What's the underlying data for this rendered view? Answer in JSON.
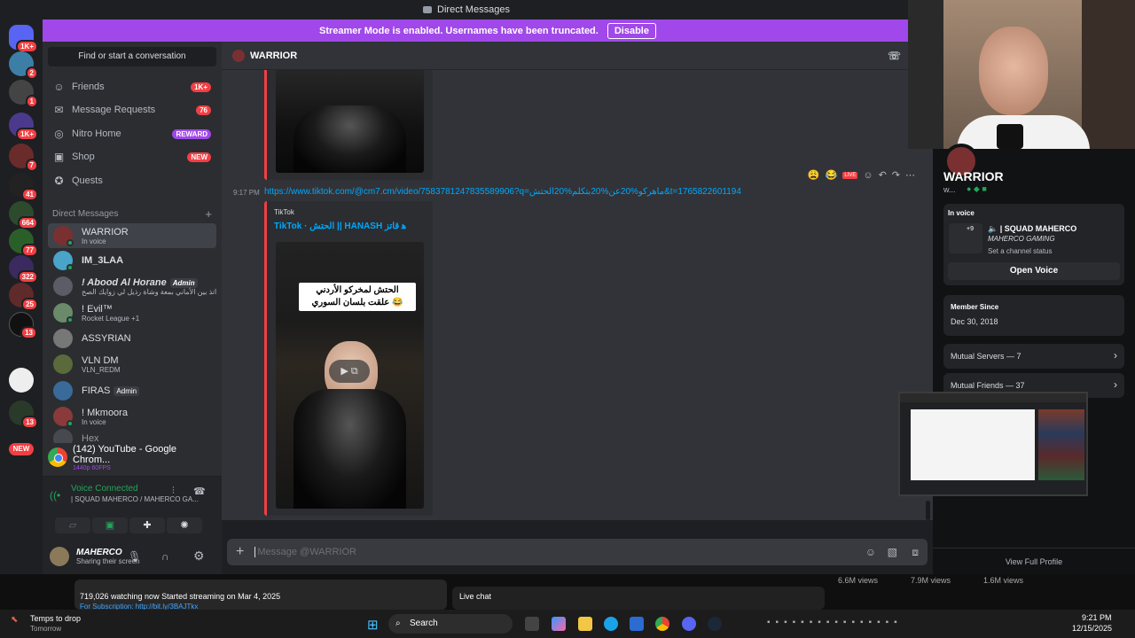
{
  "window": {
    "title": "Direct Messages"
  },
  "banner": {
    "text": "Streamer Mode is enabled. Usernames have been truncated.",
    "button": "Disable"
  },
  "rail": {
    "badges": [
      "1K+",
      "2",
      "1",
      "1K+",
      "7",
      "41",
      "664",
      "77",
      "322",
      "25",
      "13",
      "13"
    ],
    "new_label": "NEW"
  },
  "sidebar": {
    "search_placeholder": "Find or start a conversation",
    "nav": [
      {
        "label": "Friends",
        "badge": "1K+",
        "icon": "friends-icon"
      },
      {
        "label": "Message Requests",
        "badge": "76",
        "icon": "mail-icon"
      },
      {
        "label": "Nitro Home",
        "badge": "REWARD",
        "icon": "nitro-icon"
      },
      {
        "label": "Shop",
        "badge": "NEW",
        "icon": "shop-icon"
      },
      {
        "label": "Quests",
        "badge": "",
        "icon": "quests-icon"
      }
    ],
    "dm_header": "Direct Messages",
    "dms": [
      {
        "name": "WARRIOR",
        "sub": "In voice"
      },
      {
        "name": "IM_3LAA",
        "sub": ""
      },
      {
        "name": "! Abood Al Horane",
        "tag": "Admin",
        "sub": "اتذ بين الأماني بمعة وشاة رذيل لي زوايك الصح..."
      },
      {
        "name": "! Evil™",
        "sub": "Rocket League +1"
      },
      {
        "name": "ASSYRIAN",
        "sub": ""
      },
      {
        "name": "VLN DM",
        "sub": "VLN_REDM"
      },
      {
        "name": "FIRAS",
        "tag": "Admin",
        "sub": ""
      },
      {
        "name": "! Mkmoora",
        "sub": "In voice"
      },
      {
        "name": "Hex",
        "sub": ""
      }
    ],
    "stream": {
      "title": "(142) YouTube - Google Chrom...",
      "quality": "1440p 60FPS"
    },
    "voice": {
      "status": "Voice Connected",
      "channel": "| SQUAD MAHERCO / MAHERCO GA..."
    },
    "user": {
      "name": "MAHERCO",
      "status": "Sharing their screen"
    }
  },
  "chat": {
    "header": "WARRIOR",
    "time": "9:17 PM",
    "link": "https://www.tiktok.com/@cm7.cm/video/7583781247835589906?q=ماهركو%20عن%20بتكلم%20الحتش&t=1765822601194",
    "embed_provider": "TikTok",
    "embed_title": "TikTok · الحتش || HANASH ﮬ قاتز",
    "caption_line1": "الحتش لمخركو الأردني",
    "caption_line2": "علقت بلسان السوري 😂",
    "input_placeholder": "Message @WARRIOR",
    "live_label": "LIVE"
  },
  "profile": {
    "name": "WARRIOR",
    "short": "w...",
    "in_voice_label": "In voice",
    "voice_channel": "| SQUAD MAHERCO",
    "voice_server": "MAHERCO GAMING",
    "voice_count": "+9",
    "channel_status": "Set a channel status",
    "open_voice": "Open Voice",
    "member_since_label": "Member Since",
    "member_since": "Dec 30, 2018",
    "mutual_servers": "Mutual Servers — 7",
    "mutual_friends": "Mutual Friends — 37",
    "view_full": "View Full Profile"
  },
  "youtube": {
    "watching": "719,026 watching now  Started streaming on Mar 4, 2025",
    "subscription": "For Subscription: http://bit.ly/3BAJTkx",
    "live_chat": "Live chat",
    "views": [
      "6.6M views",
      "7.9M views",
      "1.6M views"
    ]
  },
  "taskbar": {
    "widget_title": "Temps to drop",
    "widget_sub": "Tomorrow",
    "search": "Search",
    "time": "9:21 PM",
    "date": "12/15/2025"
  }
}
